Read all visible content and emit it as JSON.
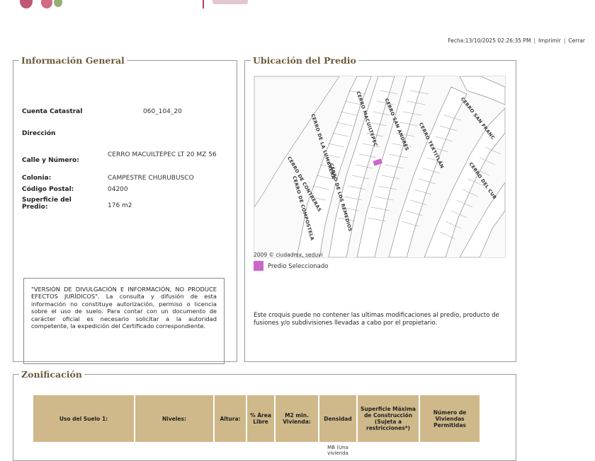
{
  "header": {
    "fecha": "Fecha:13/10/2025 02:26:35 PM",
    "link1": "Imprimir",
    "link2": "Cerrar"
  },
  "info": {
    "legend": "Información General",
    "cuenta_label": "Cuenta Catastral",
    "cuenta_value": "060_104_20",
    "direccion_label": "Dirección",
    "calle_label": "Calle y Número:",
    "calle_value": "CERRO MACUILTEPEC LT 20 MZ 56",
    "colonia_label": "Colonia:",
    "colonia_value": "CAMPESTRE CHURUBUSCO",
    "cp_label": "Código Postal:",
    "cp_value": "04200",
    "superficie_label": "Superficie del Predio:",
    "superficie_value": "176 m2",
    "notice": "\"VERSIÓN DE DIVULGACIÓN E INFORMACIÓN, NO PRODUCE EFECTOS JURÍDICOS\". La consulta y difusión de esta información no constituye autorización, permiso o licencia sobre el uso de suelo. Para contar con un documento de carácter oficial es necesario solicitar a la autoridad competente, la expedición del Certificado correspondiente."
  },
  "ubicacion": {
    "legend": "Ubicación del Predio",
    "streets": [
      "CERRO DE LA LUMBRERA",
      "CERRO MACUILTEPEC",
      "CERRO SAN ANDRÉS",
      "CERRO TEXTITLÁN",
      "CERRO SAN FRANC",
      "CERRO DEL CUB",
      "CERRO DE COMPOSTELA",
      "CERRO DE LOS REMEDIOS",
      "CERRO DE CONTRERAS"
    ],
    "copyright": "2009 © ciudadmx, seduvi",
    "legend_label": "Predio Seleccionado",
    "highlight_color": "#cc66cc",
    "croquis": "Este croquis puede no contener las ultimas modificaciones al predio, producto de fusiones y/o subdivisiones llevadas a cabo por el propietario."
  },
  "zonificacion": {
    "legend": "Zonificación",
    "headers": [
      "Uso del Suelo 1:",
      "Niveles:",
      "Altura:",
      "% Área Libre",
      "M2 min. Vivienda:",
      "Densidad",
      "Superficie Máxima de Construcción (Sujeta a restricciones*)",
      "Número de Viviendas Permitidas"
    ],
    "row": [
      "",
      "",
      "",
      "",
      "",
      "MB (Una vivienda",
      "",
      ""
    ]
  }
}
